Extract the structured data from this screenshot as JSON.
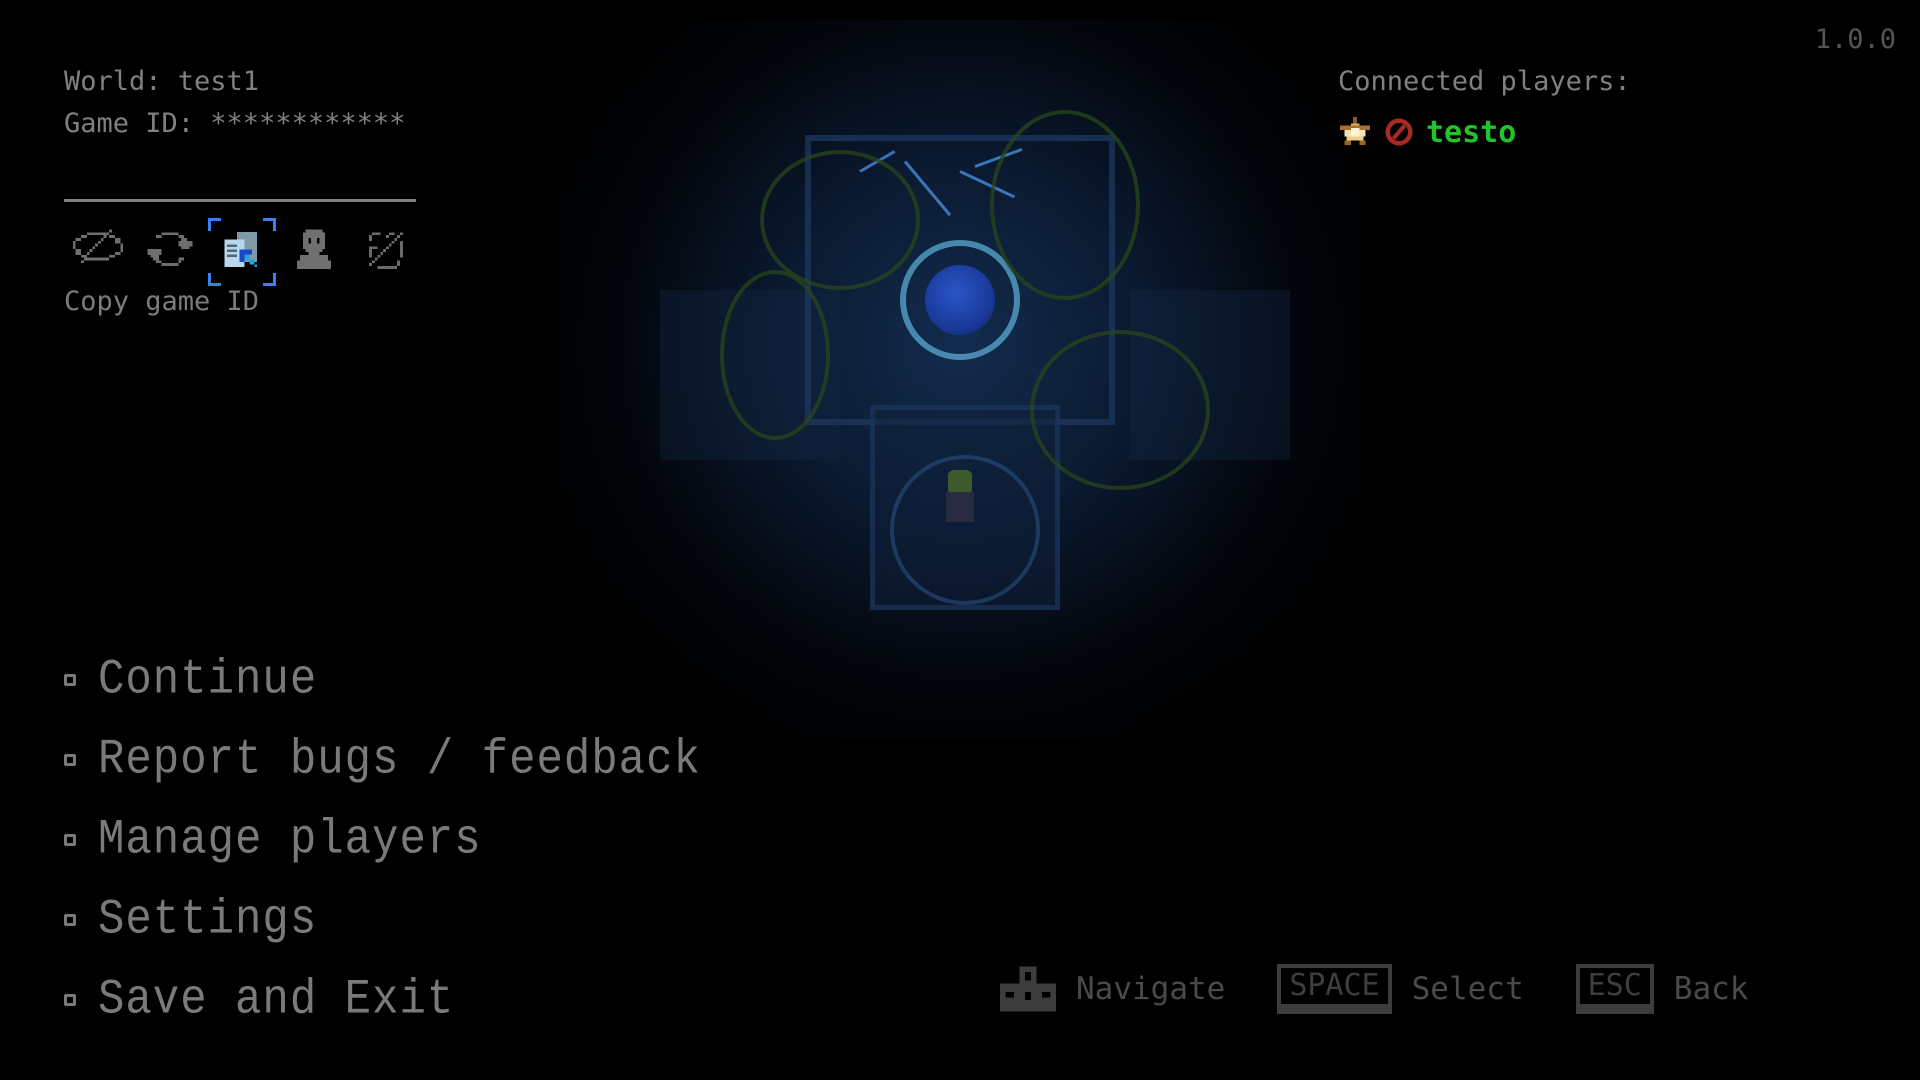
{
  "hud": {
    "world_label": "World: test1",
    "game_id_label": "Game ID: ************",
    "version": "1.0.0"
  },
  "toolbar": {
    "icons": [
      {
        "name": "hide-game-id-icon",
        "selected": false
      },
      {
        "name": "refresh-icon",
        "selected": false
      },
      {
        "name": "copy-game-id-icon",
        "selected": true
      },
      {
        "name": "player-icon",
        "selected": false
      },
      {
        "name": "disable-icon",
        "selected": false
      }
    ],
    "tooltip": "Copy game ID",
    "selection_color": "#3b7ef0"
  },
  "players": {
    "heading": "Connected players:",
    "list": [
      {
        "name": "testo",
        "host_icon": "star-icon",
        "status_icon": "ban-icon",
        "name_color": "#1fc52a"
      }
    ]
  },
  "menu": {
    "items": [
      {
        "label": "Continue"
      },
      {
        "label": "Report bugs / feedback"
      },
      {
        "label": "Manage players"
      },
      {
        "label": "Settings"
      },
      {
        "label": "Save and Exit"
      }
    ]
  },
  "hints": {
    "navigate_label": "Navigate",
    "select_key": "SPACE",
    "select_label": "Select",
    "back_key": "ESC",
    "back_label": "Back"
  }
}
